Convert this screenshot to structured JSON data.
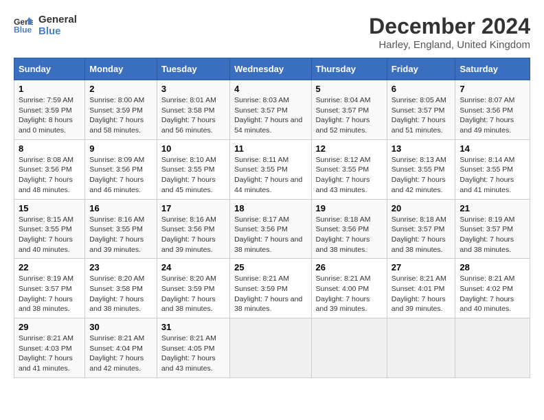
{
  "header": {
    "logo_line1": "General",
    "logo_line2": "Blue",
    "title": "December 2024",
    "subtitle": "Harley, England, United Kingdom"
  },
  "columns": [
    "Sunday",
    "Monday",
    "Tuesday",
    "Wednesday",
    "Thursday",
    "Friday",
    "Saturday"
  ],
  "weeks": [
    [
      {
        "day": "1",
        "sunrise": "Sunrise: 7:59 AM",
        "sunset": "Sunset: 3:59 PM",
        "daylight": "Daylight: 8 hours and 0 minutes."
      },
      {
        "day": "2",
        "sunrise": "Sunrise: 8:00 AM",
        "sunset": "Sunset: 3:59 PM",
        "daylight": "Daylight: 7 hours and 58 minutes."
      },
      {
        "day": "3",
        "sunrise": "Sunrise: 8:01 AM",
        "sunset": "Sunset: 3:58 PM",
        "daylight": "Daylight: 7 hours and 56 minutes."
      },
      {
        "day": "4",
        "sunrise": "Sunrise: 8:03 AM",
        "sunset": "Sunset: 3:57 PM",
        "daylight": "Daylight: 7 hours and 54 minutes."
      },
      {
        "day": "5",
        "sunrise": "Sunrise: 8:04 AM",
        "sunset": "Sunset: 3:57 PM",
        "daylight": "Daylight: 7 hours and 52 minutes."
      },
      {
        "day": "6",
        "sunrise": "Sunrise: 8:05 AM",
        "sunset": "Sunset: 3:57 PM",
        "daylight": "Daylight: 7 hours and 51 minutes."
      },
      {
        "day": "7",
        "sunrise": "Sunrise: 8:07 AM",
        "sunset": "Sunset: 3:56 PM",
        "daylight": "Daylight: 7 hours and 49 minutes."
      }
    ],
    [
      {
        "day": "8",
        "sunrise": "Sunrise: 8:08 AM",
        "sunset": "Sunset: 3:56 PM",
        "daylight": "Daylight: 7 hours and 48 minutes."
      },
      {
        "day": "9",
        "sunrise": "Sunrise: 8:09 AM",
        "sunset": "Sunset: 3:56 PM",
        "daylight": "Daylight: 7 hours and 46 minutes."
      },
      {
        "day": "10",
        "sunrise": "Sunrise: 8:10 AM",
        "sunset": "Sunset: 3:55 PM",
        "daylight": "Daylight: 7 hours and 45 minutes."
      },
      {
        "day": "11",
        "sunrise": "Sunrise: 8:11 AM",
        "sunset": "Sunset: 3:55 PM",
        "daylight": "Daylight: 7 hours and 44 minutes."
      },
      {
        "day": "12",
        "sunrise": "Sunrise: 8:12 AM",
        "sunset": "Sunset: 3:55 PM",
        "daylight": "Daylight: 7 hours and 43 minutes."
      },
      {
        "day": "13",
        "sunrise": "Sunrise: 8:13 AM",
        "sunset": "Sunset: 3:55 PM",
        "daylight": "Daylight: 7 hours and 42 minutes."
      },
      {
        "day": "14",
        "sunrise": "Sunrise: 8:14 AM",
        "sunset": "Sunset: 3:55 PM",
        "daylight": "Daylight: 7 hours and 41 minutes."
      }
    ],
    [
      {
        "day": "15",
        "sunrise": "Sunrise: 8:15 AM",
        "sunset": "Sunset: 3:55 PM",
        "daylight": "Daylight: 7 hours and 40 minutes."
      },
      {
        "day": "16",
        "sunrise": "Sunrise: 8:16 AM",
        "sunset": "Sunset: 3:55 PM",
        "daylight": "Daylight: 7 hours and 39 minutes."
      },
      {
        "day": "17",
        "sunrise": "Sunrise: 8:16 AM",
        "sunset": "Sunset: 3:56 PM",
        "daylight": "Daylight: 7 hours and 39 minutes."
      },
      {
        "day": "18",
        "sunrise": "Sunrise: 8:17 AM",
        "sunset": "Sunset: 3:56 PM",
        "daylight": "Daylight: 7 hours and 38 minutes."
      },
      {
        "day": "19",
        "sunrise": "Sunrise: 8:18 AM",
        "sunset": "Sunset: 3:56 PM",
        "daylight": "Daylight: 7 hours and 38 minutes."
      },
      {
        "day": "20",
        "sunrise": "Sunrise: 8:18 AM",
        "sunset": "Sunset: 3:57 PM",
        "daylight": "Daylight: 7 hours and 38 minutes."
      },
      {
        "day": "21",
        "sunrise": "Sunrise: 8:19 AM",
        "sunset": "Sunset: 3:57 PM",
        "daylight": "Daylight: 7 hours and 38 minutes."
      }
    ],
    [
      {
        "day": "22",
        "sunrise": "Sunrise: 8:19 AM",
        "sunset": "Sunset: 3:57 PM",
        "daylight": "Daylight: 7 hours and 38 minutes."
      },
      {
        "day": "23",
        "sunrise": "Sunrise: 8:20 AM",
        "sunset": "Sunset: 3:58 PM",
        "daylight": "Daylight: 7 hours and 38 minutes."
      },
      {
        "day": "24",
        "sunrise": "Sunrise: 8:20 AM",
        "sunset": "Sunset: 3:59 PM",
        "daylight": "Daylight: 7 hours and 38 minutes."
      },
      {
        "day": "25",
        "sunrise": "Sunrise: 8:21 AM",
        "sunset": "Sunset: 3:59 PM",
        "daylight": "Daylight: 7 hours and 38 minutes."
      },
      {
        "day": "26",
        "sunrise": "Sunrise: 8:21 AM",
        "sunset": "Sunset: 4:00 PM",
        "daylight": "Daylight: 7 hours and 39 minutes."
      },
      {
        "day": "27",
        "sunrise": "Sunrise: 8:21 AM",
        "sunset": "Sunset: 4:01 PM",
        "daylight": "Daylight: 7 hours and 39 minutes."
      },
      {
        "day": "28",
        "sunrise": "Sunrise: 8:21 AM",
        "sunset": "Sunset: 4:02 PM",
        "daylight": "Daylight: 7 hours and 40 minutes."
      }
    ],
    [
      {
        "day": "29",
        "sunrise": "Sunrise: 8:21 AM",
        "sunset": "Sunset: 4:03 PM",
        "daylight": "Daylight: 7 hours and 41 minutes."
      },
      {
        "day": "30",
        "sunrise": "Sunrise: 8:21 AM",
        "sunset": "Sunset: 4:04 PM",
        "daylight": "Daylight: 7 hours and 42 minutes."
      },
      {
        "day": "31",
        "sunrise": "Sunrise: 8:21 AM",
        "sunset": "Sunset: 4:05 PM",
        "daylight": "Daylight: 7 hours and 43 minutes."
      },
      null,
      null,
      null,
      null
    ]
  ]
}
